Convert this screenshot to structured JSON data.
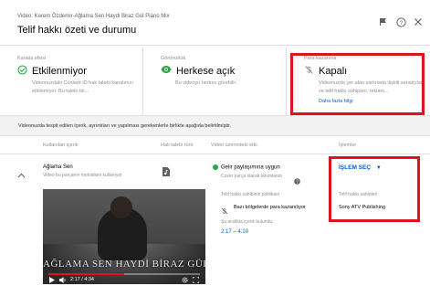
{
  "header": {
    "video_line": "Video: Kerem Özdemir-Ağlama Sen Haydi Biraz Gül Piano Mix",
    "title": "Telif hakkı özeti ve durumu",
    "icons": [
      "flag-icon",
      "help-icon",
      "close-icon"
    ]
  },
  "cards": [
    {
      "label": "Kanala etkisi",
      "title": "Etkilenmiyor",
      "icon": "check-circle-icon",
      "description": "Videonuzdaki Content ID hak talebi kanalınızı etkilemiyor. Bu talebi bir..."
    },
    {
      "label": "Görünürlük",
      "title": "Herkese açık",
      "icon": "eye-icon",
      "description": "Bu videoyu herkes görebilir."
    },
    {
      "label": "Para kazanma",
      "title": "Kapalı",
      "icon": "no-dollar-icon",
      "description": "Videonuzda yer alan şarkılarla ilişkili sanatçılar ve telif hakkı sahipleri, reklam...",
      "link": "Daha fazla bilgi"
    }
  ],
  "notice": "Videonuzda tespit edilen içerik, ayrıntıları ve yapılması gerekenlerle birlikte aşağıda belirtilmiştir.",
  "table": {
    "headers": [
      "Kullanılan içerik",
      "Hak talebi türü",
      "Video üzerindeki etki",
      "İşlemler"
    ],
    "row": {
      "song_title": "Ağlama Sen",
      "song_subtitle": "Video bu parçanın melodisini kullanıyor",
      "effect_title": "Gelir paylaşımına uygun",
      "effect_subtitle": "Cover parça olarak tanımlandı",
      "action_label": "İŞLEM SEÇ",
      "policy_label": "Telif hakkı sahibinin politikası",
      "policy_value": "Bazı bölgelerde para kazanılıyor",
      "owner_label": "Telif hakkı sahipleri",
      "owner_value": "Sony ATV Publishing",
      "found_label": "Şu aralıkta içerik bulundu:",
      "found_range": "2:17 – 4:10"
    }
  },
  "video": {
    "overlay_text": "AĞLAMA SEN HAYDİ BİRAZ GÜL",
    "time": "2:17 / 4:34",
    "progress": 0.5
  },
  "colors": {
    "accent": "#065fd4",
    "highlight": "#e0131b",
    "success": "#2ba640"
  }
}
